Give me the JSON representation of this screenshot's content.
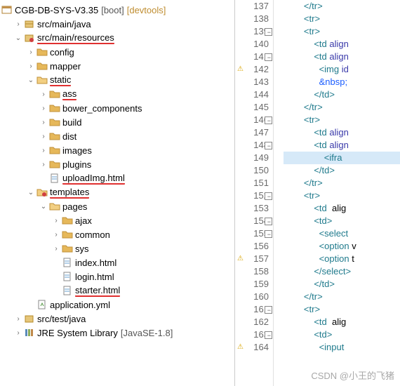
{
  "project": {
    "name": "CGB-DB-SYS-V3.35",
    "boot_suffix": "[boot]",
    "devtools_suffix": "[devtools]"
  },
  "tree": {
    "src_main_java": "src/main/java",
    "src_main_resources": "src/main/resources",
    "config": "config",
    "mapper": "mapper",
    "static": "static",
    "ass": "ass",
    "bower_components": "bower_components",
    "build": "build",
    "dist": "dist",
    "images": "images",
    "plugins": "plugins",
    "uploadImg": "uploadImg.html",
    "templates": "templates",
    "pages": "pages",
    "ajax": "ajax",
    "common": "common",
    "sys": "sys",
    "index_html": "index.html",
    "login_html": "login.html",
    "starter_html": "starter.html",
    "application_yml": "application.yml",
    "src_test_java": "src/test/java",
    "jre": "JRE System Library",
    "jre_env": "[JavaSE-1.8]"
  },
  "gutter": {
    "l137": "137",
    "l138": "138",
    "l139": "139",
    "l140": "140",
    "l141": "141",
    "l142": "142",
    "l143": "143",
    "l144": "144",
    "l145": "145",
    "l146": "146",
    "l147": "147",
    "l148": "148",
    "l149": "149",
    "l150": "150",
    "l151": "151",
    "l152": "152",
    "l153": "153",
    "l154": "154",
    "l155": "155",
    "l156": "156",
    "l157": "157",
    "l158": "158",
    "l159": "159",
    "l160": "160",
    "l161": "161",
    "l162": "162",
    "l163": "163",
    "l164": "164"
  },
  "code": {
    "c137": "        </tr>",
    "c138": "        <tr>",
    "c139": "        <tr>",
    "c140": "            <td align",
    "c141": "            <td align",
    "c142": "              <img id",
    "c143": "              &nbsp;",
    "c144": "            </td>",
    "c145": "        </tr>",
    "c146": "        <tr>",
    "c147": "            <td align",
    "c148": "            <td align",
    "c149": "                <ifra",
    "c150": "            </td>",
    "c151": "        </tr>",
    "c152": "        <tr>",
    "c153": "            <td  alig",
    "c154": "            <td>",
    "c155": "              <select ",
    "c156": "              <option v",
    "c157": "              <option t",
    "c158": "            </select>",
    "c159": "            </td>",
    "c160": "        </tr>",
    "c161": "        <tr>",
    "c162": "            <td  alig",
    "c163": "            <td>",
    "c164": "              <input "
  },
  "watermark": "CSDN @小王的飞猪"
}
